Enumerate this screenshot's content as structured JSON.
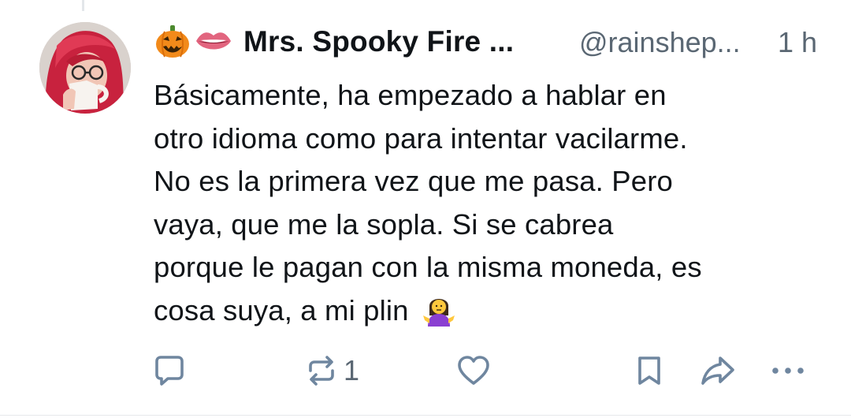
{
  "post": {
    "author": {
      "display_name": "Mrs. Spooky Fire ...",
      "handle": "@rainshep...",
      "emoji": [
        "jack-o-lantern",
        "lips"
      ]
    },
    "time": "1 h",
    "text_lines": [
      "Básicamente, ha empezado a hablar en",
      "otro idioma como para intentar vacilarme.",
      "No es la primera vez que me pasa. Pero",
      "vaya, que me la sopla. Si se cabrea",
      "porque le pagan con la misma moneda, es",
      "cosa suya, a mi plin"
    ],
    "trailing_emoji": "woman-shrugging"
  },
  "actions": {
    "reply_count": "",
    "repost_count": "1",
    "like_count": ""
  },
  "colors": {
    "text": "#101418",
    "muted": "#5a6773",
    "icon": "#6f869f",
    "divider": "#e6e8eb"
  }
}
